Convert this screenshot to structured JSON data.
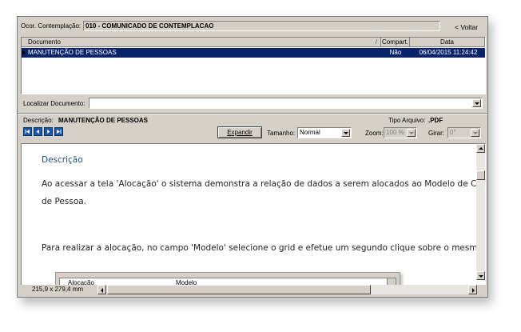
{
  "header": {
    "ocorrencia_label": "Ocor. Contemplação:",
    "ocorrencia_value": "010 - COMUNICADO DE CONTEMPLACAO",
    "back_label": "< Voltar"
  },
  "grid": {
    "columns": [
      "Documento",
      "Compart.",
      "Data"
    ],
    "rows": [
      {
        "documento": "MANUTENÇÃO DE PESSOAS",
        "compart": "Não",
        "data": "06/04/2015 11:24:42"
      }
    ]
  },
  "locate": {
    "label": "Localizar Documento:",
    "value": ""
  },
  "description": {
    "label": "Descrição:",
    "value": "MANUTENÇÃO DE PESSOAS",
    "file_type_label": "Tipo Arquivo:",
    "file_type_value": ".PDF"
  },
  "toolbar": {
    "expand_label": "Expandir",
    "size_label": "Tamanho:",
    "size_value": "Normal",
    "zoom_label": "Zoom:",
    "zoom_value": "100 %",
    "rotate_label": "Girar:",
    "rotate_value": "0°"
  },
  "document": {
    "heading": "Descrição",
    "paragraph1_line1": "Ao acessar a tela 'Alocação' o sistema demonstra a relação de dados a serem alocados ao Modelo de Cadas",
    "paragraph1_line2": "de Pessoa.",
    "paragraph2": "Para realizar a alocação, no campo 'Modelo' selecione o grid e efetue um segundo clique sobre o mesmo.",
    "embedded_col1": "Alocação",
    "embedded_col2": "Modelo"
  },
  "status": {
    "page_size": "215,9 x 279,4 mm"
  },
  "colors": {
    "selection": "#0a246a",
    "heading": "#1f4e79",
    "nav": "#1a57a8"
  }
}
